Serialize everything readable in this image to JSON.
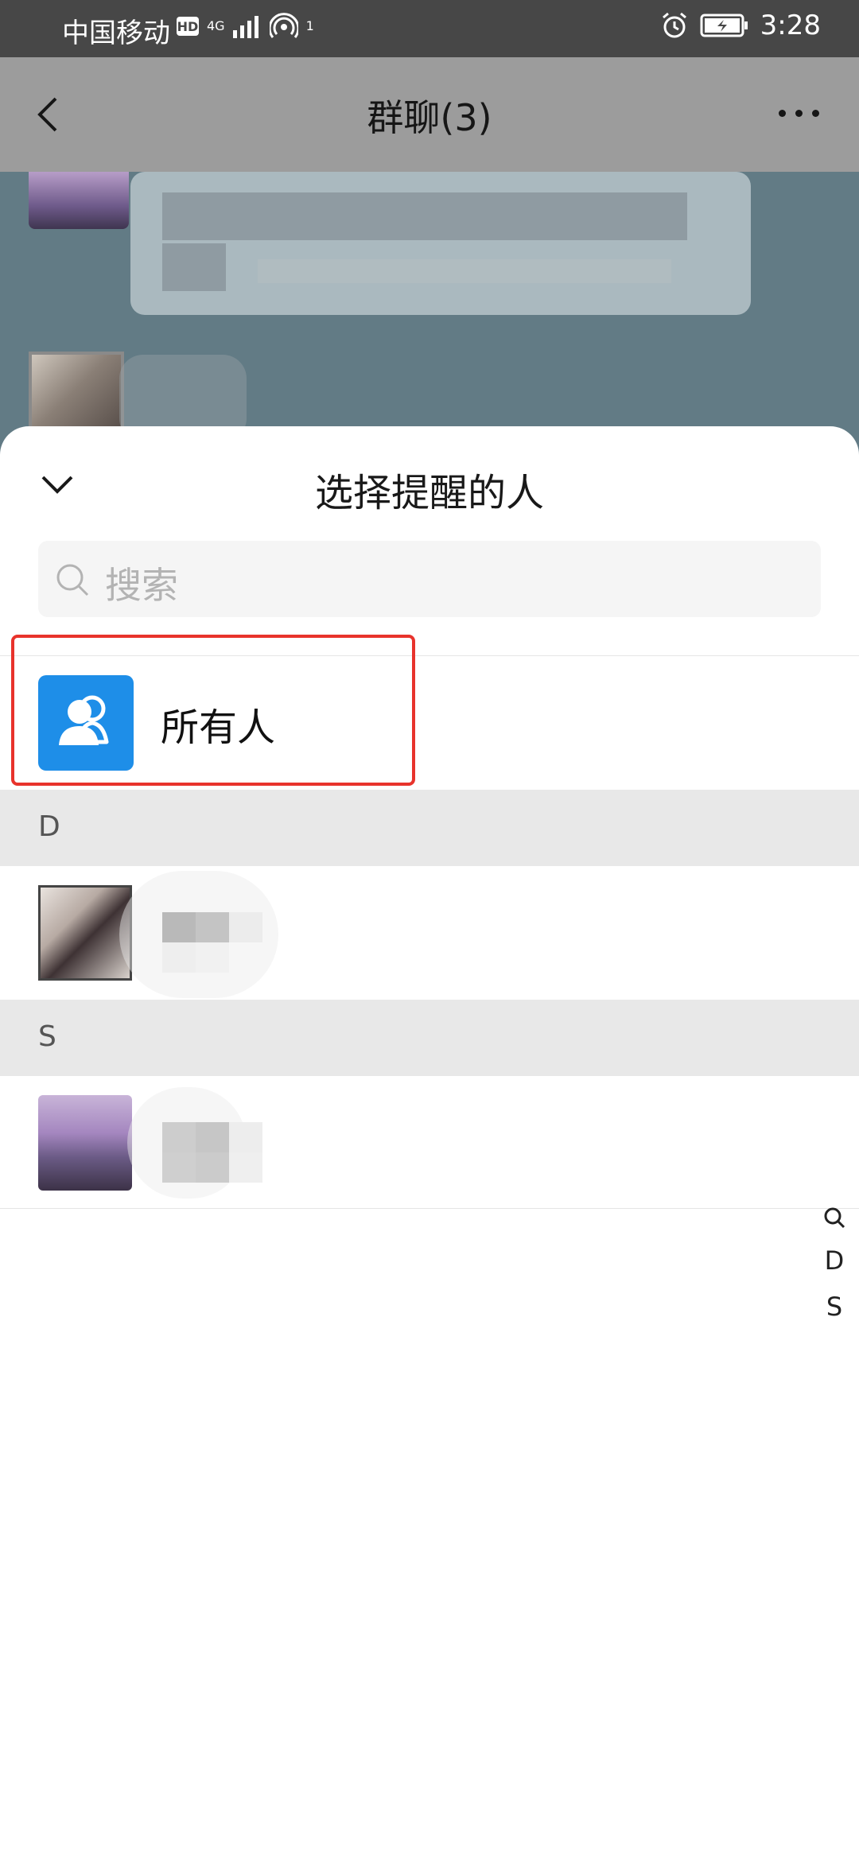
{
  "status_bar": {
    "carrier": "中国移动",
    "hd_badge": "HD",
    "network": "4G",
    "hotspot_count": "1",
    "time": "3:28"
  },
  "chat": {
    "title": "群聊(3)"
  },
  "sheet": {
    "title": "选择提醒的人",
    "search_placeholder": "搜索",
    "everyone_label": "所有人",
    "sections": [
      {
        "letter": "D"
      },
      {
        "letter": "S"
      }
    ],
    "index_bar": [
      "D",
      "S"
    ]
  },
  "colors": {
    "accent_blue": "#1e8ee8",
    "highlight_red": "#e8332c",
    "status_bar": "#474747",
    "section_bg": "#e8e8e8"
  },
  "icons": [
    "back-icon",
    "more-icon",
    "collapse-icon",
    "search-icon",
    "group-people-icon",
    "alarm-icon",
    "battery-icon"
  ]
}
